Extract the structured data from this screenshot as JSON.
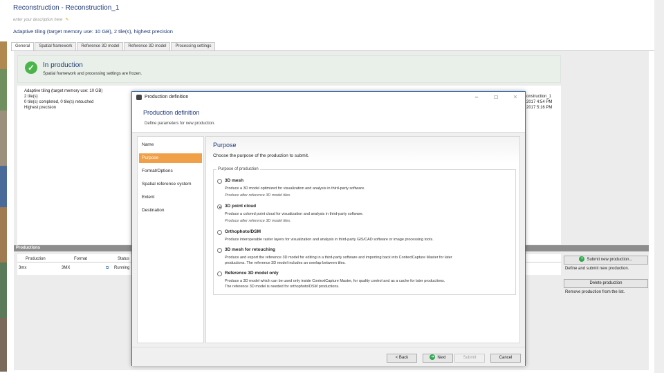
{
  "main": {
    "title": "Reconstruction - Reconstruction_1",
    "description_placeholder": "enter your description here",
    "summary": "Adaptive tiling (target memory use: 10 GB), 2 tile(s), highest precision",
    "tabs": [
      "General",
      "Spatial framework",
      "Reference 3D model",
      "Reference 3D model",
      "Processing settings"
    ]
  },
  "status": {
    "title": "In production",
    "subtitle": "Spatial framework and processing settings are frozen."
  },
  "info": {
    "lines": [
      "Adaptive tiling (target memory use: 10 GB)",
      "2 tile(s)",
      "0 tile(s) completed, 0 tile(s) retouched",
      "Highest precision"
    ],
    "right_lines": [
      "onstruction_1",
      "2017 4:54 PM",
      "2017 5:16 PM"
    ]
  },
  "productions": {
    "bar_label": "Productions",
    "headers": [
      "Production",
      "Format",
      "Status"
    ],
    "row": {
      "name": "3mx",
      "format": "3MX",
      "status": "Running"
    }
  },
  "side": {
    "submit_label": "Submit new production...",
    "submit_desc": "Define and submit new production.",
    "delete_label": "Delete production",
    "delete_desc": "Remove production from the list."
  },
  "dialog": {
    "window_title": "Production definition",
    "header_title": "Production definition",
    "header_sub": "Define parameters for new production.",
    "nav": [
      "Name",
      "Purpose",
      "Format/Options",
      "Spatial reference system",
      "Extent",
      "Destination"
    ],
    "purpose_title": "Purpose",
    "purpose_sub": "Choose the purpose of the production to submit.",
    "group_label": "Purpose of production",
    "options": [
      {
        "label": "3D mesh",
        "desc": "Produce a 3D model optimized for visualization and analysis in third-party software.",
        "note": "Produce after reference 3D model tiles."
      },
      {
        "label": "3D point cloud",
        "desc": "Produce a colored point cloud for visualization and analysis in third-party software.",
        "note": "Produce after reference 3D model tiles."
      },
      {
        "label": "Orthophoto/DSM",
        "desc": "Produce interoperable raster layers for visualization and analysis in third-party GIS/CAD software or image processing tools.",
        "note": ""
      },
      {
        "label": "3D mesh for retouching",
        "desc": "Produce and export the reference 3D model for editing in a third-party software and importing back into ContextCapture Master for later",
        "desc2": "productions. The reference 3D model includes an overlap between tiles."
      },
      {
        "label": "Reference 3D model only",
        "desc": "Produce a 3D model which can be used only inside ContextCapture Master, for quality control and as a cache for later productions.",
        "desc2": "The reference 3D model is needed for orthophoto/DSM productions."
      }
    ],
    "buttons": {
      "back": "< Back",
      "next": "Next",
      "submit": "Submit",
      "cancel": "Cancel"
    }
  }
}
